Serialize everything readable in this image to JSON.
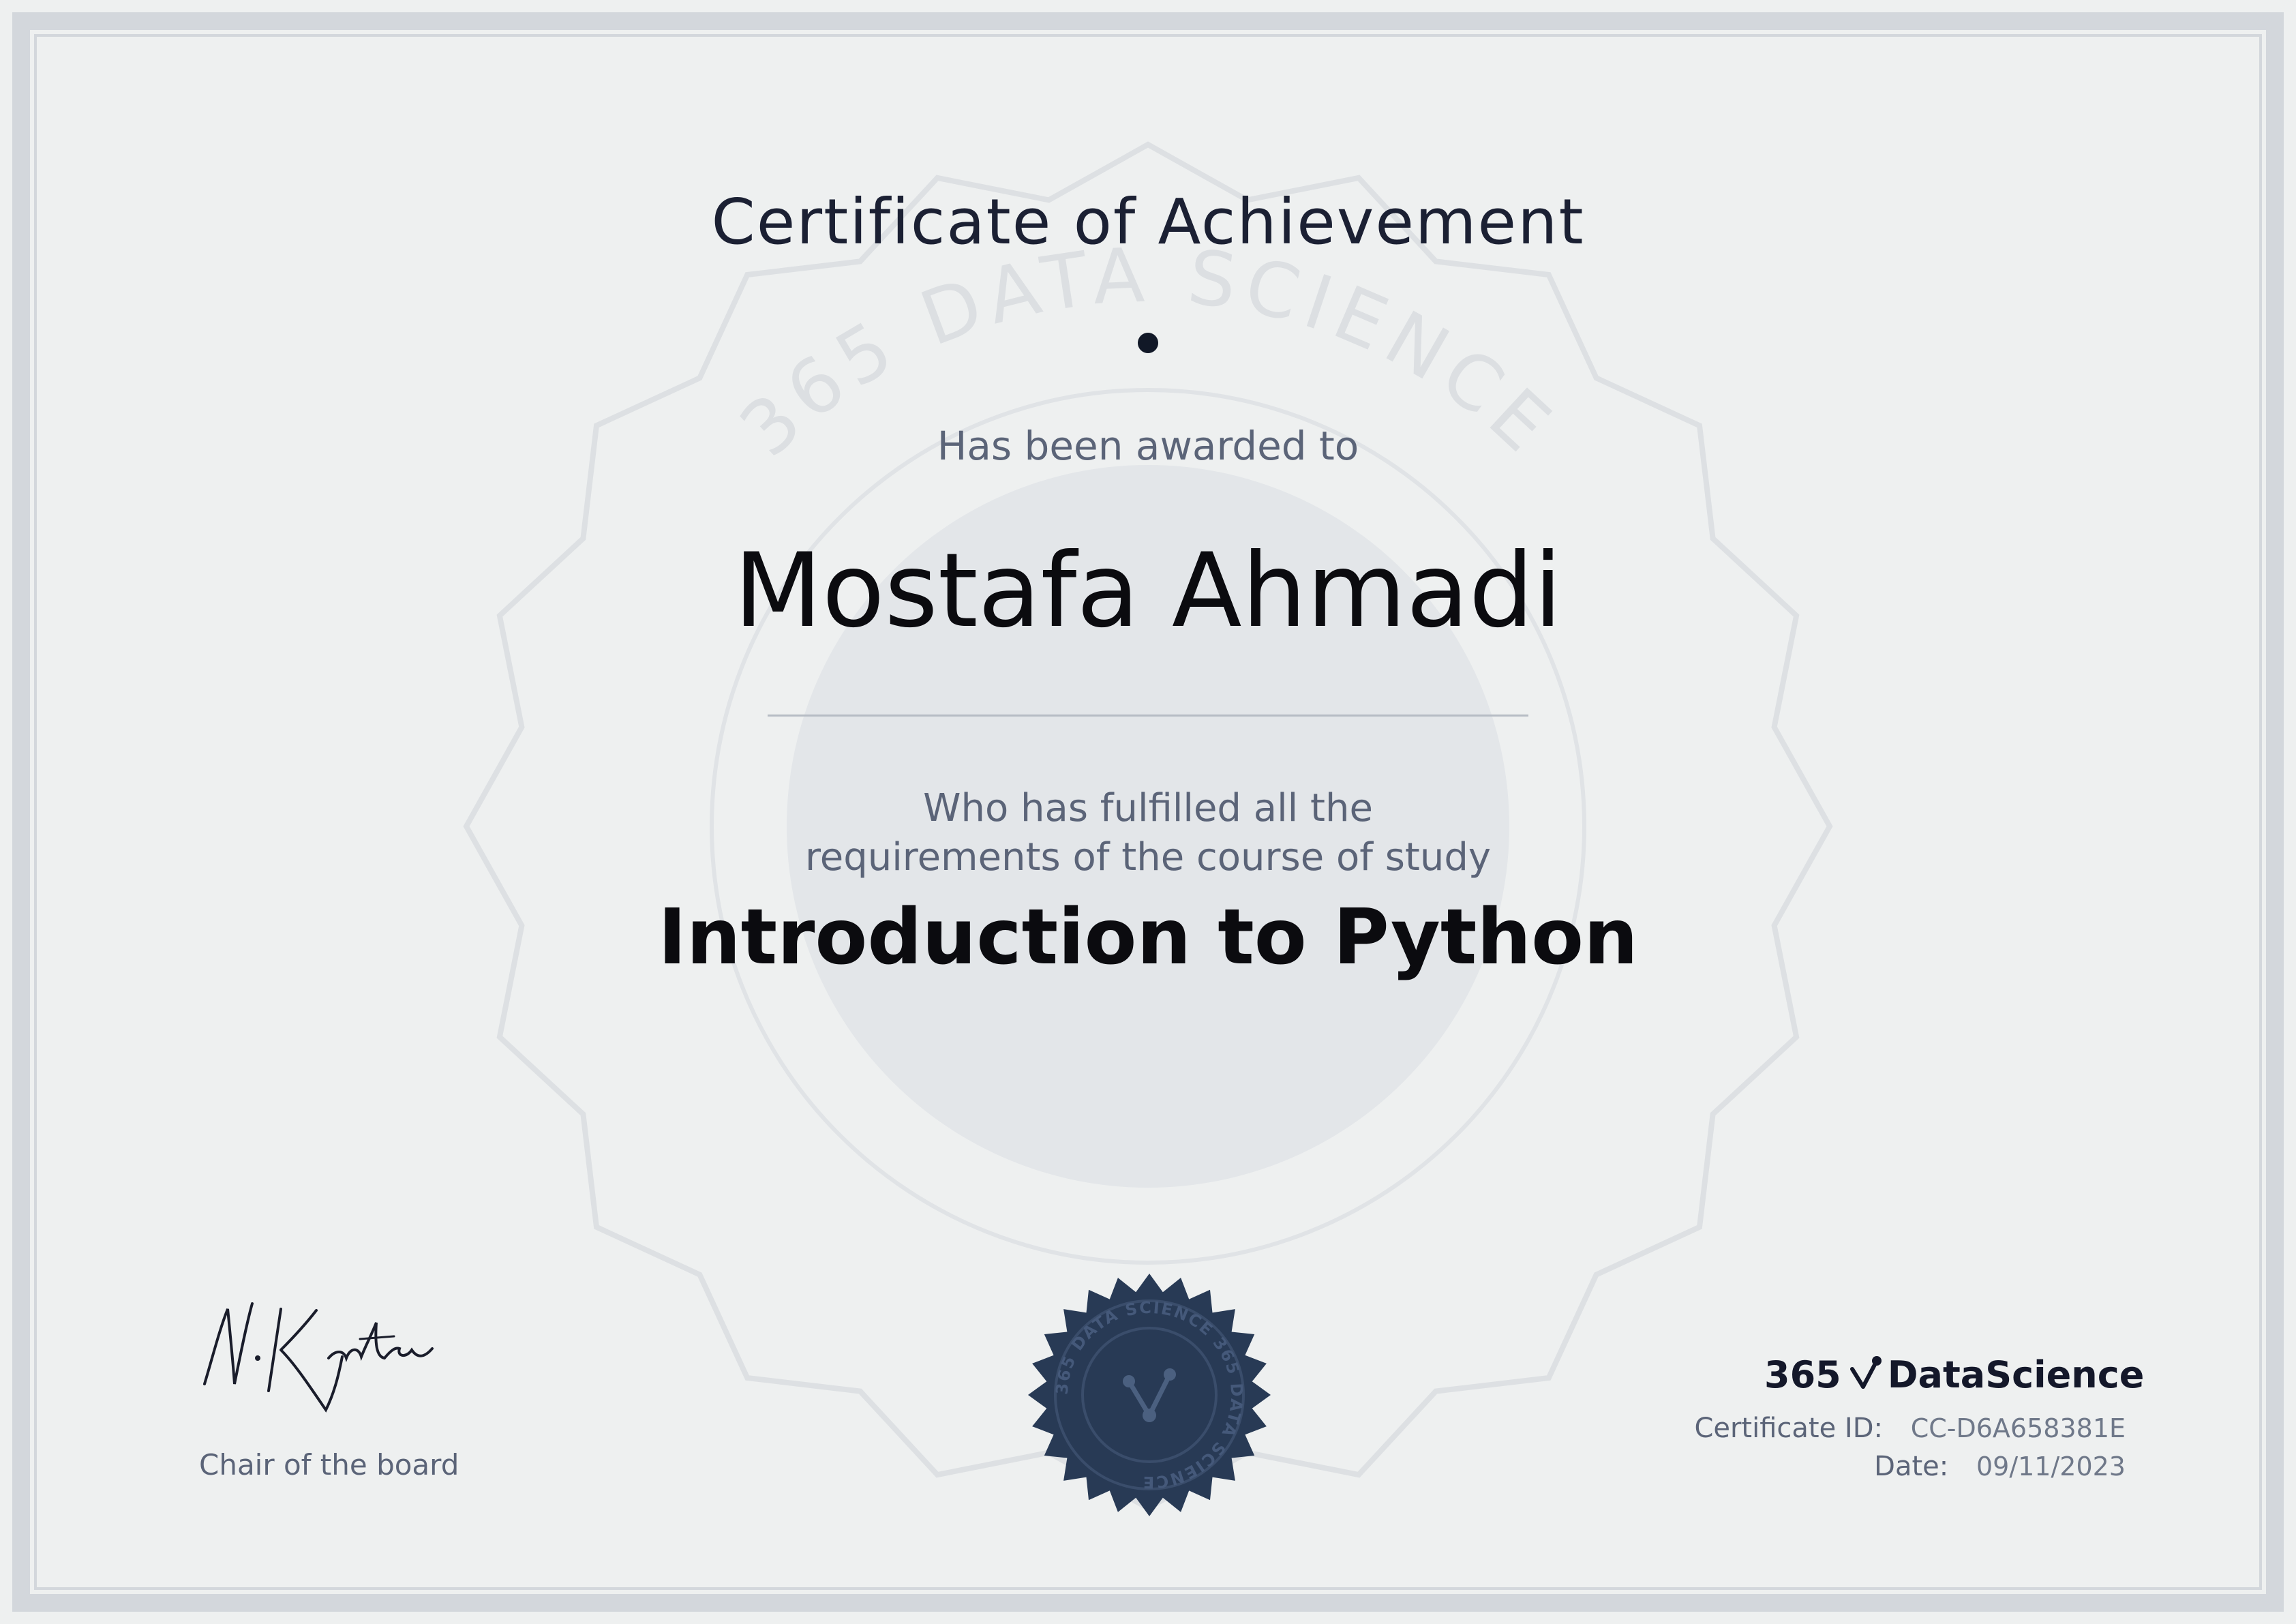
{
  "certificate": {
    "title": "Certificate of Achievement",
    "awarded_text": "Has been awarded to",
    "recipient_name": "Mostafa Ahmadi",
    "fulfilled_line1": "Who has fulfilled all the",
    "fulfilled_line2": "requirements of the course of study",
    "course_name": "Introduction to Python"
  },
  "signature": {
    "text": "N.Krastev",
    "role": "Chair of the board"
  },
  "seal": {
    "text": "365 DATA SCIENCE 365 DATA SCIENCE"
  },
  "watermark": {
    "text": "365 DATA SCIENCE"
  },
  "brand": {
    "prefix": "365",
    "name": "DataScience"
  },
  "meta": {
    "id_label": "Certificate ID:",
    "id_value": "CC-D6A658381E",
    "date_label": "Date:",
    "date_value": "09/11/2023"
  },
  "colors": {
    "background": "#eef0f0",
    "frame": "#d3d7dc",
    "ink": "#1b2033",
    "muted": "#5b6478",
    "seal": "#283a55"
  }
}
